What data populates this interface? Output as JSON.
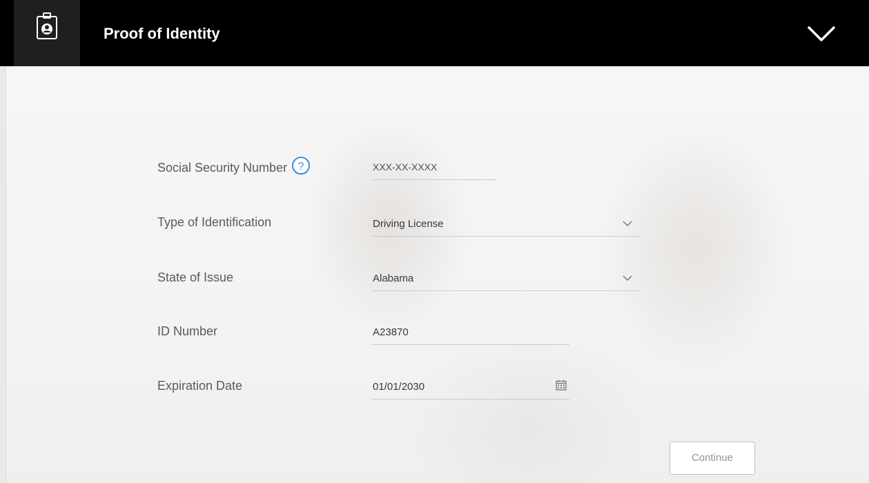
{
  "header": {
    "title": "Proof of Identity",
    "icon": "id-badge-icon",
    "toggle_icon": "chevron-down-icon"
  },
  "form": {
    "ssn": {
      "label": "Social Security Number",
      "help_icon": "question-circle-icon",
      "value": "XXX-XX-XXXX"
    },
    "id_type": {
      "label": "Type of Identification",
      "value": "Driving License"
    },
    "state": {
      "label": "State of Issue",
      "value": "Alabama"
    },
    "id_number": {
      "label": "ID Number",
      "value": "A23870"
    },
    "expiration": {
      "label": "Expiration Date",
      "value": "01/01/2030",
      "icon": "calendar-icon"
    }
  },
  "actions": {
    "continue_label": "Continue"
  },
  "colors": {
    "header_bg": "#000000",
    "accent": "#3a8fd8",
    "label_text": "#555b61",
    "button_border": "#a9c8e6"
  }
}
